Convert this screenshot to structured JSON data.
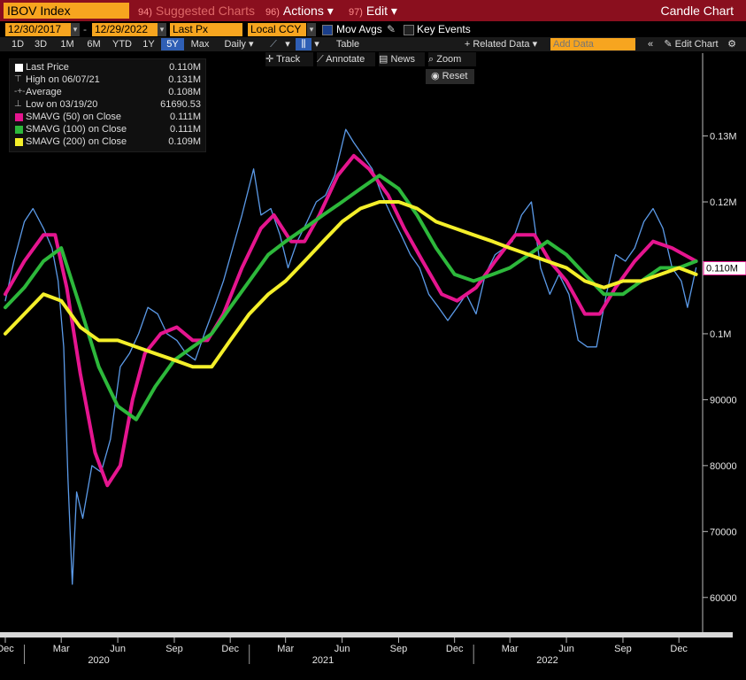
{
  "header": {
    "ticker": "IBOV Index",
    "suggested_num": "94)",
    "suggested_label": "Suggested Charts",
    "actions_num": "96)",
    "actions_label": "Actions ▾",
    "edit_num": "97)",
    "edit_label": "Edit ▾",
    "chart_title": "Candle Chart"
  },
  "toolbar2": {
    "start_date": "12/30/2017",
    "end_date": "12/29/2022",
    "price_field": "Last Px",
    "currency": "Local CCY",
    "mov_avgs_label": "Mov Avgs",
    "key_events_label": "Key Events"
  },
  "periods": [
    "1D",
    "3D",
    "1M",
    "6M",
    "YTD",
    "1Y",
    "5Y",
    "Max"
  ],
  "active_period": "5Y",
  "toolbar3": {
    "frequency": "Daily ▾",
    "table_label": "Table",
    "related_data_label": "+ Related Data ▾",
    "add_data_placeholder": "Add Data",
    "edit_chart_label": "Edit Chart"
  },
  "tools": {
    "track": "Track",
    "annotate": "Annotate",
    "news": "News",
    "zoom": "Zoom",
    "reset": "Reset"
  },
  "legend": [
    {
      "name": "Last Price",
      "value": "0.110M",
      "color": "#ffffff"
    },
    {
      "name": "High on 06/07/21",
      "value": "0.131M",
      "color": "#aaaaaa"
    },
    {
      "name": "Average",
      "value": "0.108M",
      "color": "#aaaaaa"
    },
    {
      "name": "Low on 03/19/20",
      "value": "61690.53",
      "color": "#aaaaaa"
    },
    {
      "name": "SMAVG (50)  on Close",
      "value": "0.111M",
      "color": "#e5158f"
    },
    {
      "name": "SMAVG (100)  on Close",
      "value": "0.111M",
      "color": "#2db83b"
    },
    {
      "name": "SMAVG (200)  on Close",
      "value": "0.109M",
      "color": "#f4ef2a"
    }
  ],
  "last_price_tag": "0.110M",
  "chart_data": {
    "type": "line",
    "ylim": [
      55000,
      138000
    ],
    "y_ticks": [
      {
        "v": 130000,
        "label": "0.13M"
      },
      {
        "v": 120000,
        "label": "0.12M"
      },
      {
        "v": 100000,
        "label": "0.1M"
      },
      {
        "v": 90000,
        "label": "90000"
      },
      {
        "v": 80000,
        "label": "80000"
      },
      {
        "v": 70000,
        "label": "70000"
      },
      {
        "v": 60000,
        "label": "60000"
      }
    ],
    "x_range": [
      "2019-12-01",
      "2022-12-31"
    ],
    "x_month_ticks": [
      {
        "label": "Dec",
        "date": "2019-12-01"
      },
      {
        "label": "Mar",
        "date": "2020-03-01"
      },
      {
        "label": "Jun",
        "date": "2020-06-01"
      },
      {
        "label": "Sep",
        "date": "2020-09-01"
      },
      {
        "label": "Dec",
        "date": "2020-12-01"
      },
      {
        "label": "Mar",
        "date": "2021-03-01"
      },
      {
        "label": "Jun",
        "date": "2021-06-01"
      },
      {
        "label": "Sep",
        "date": "2021-09-01"
      },
      {
        "label": "Dec",
        "date": "2021-12-01"
      },
      {
        "label": "Mar",
        "date": "2022-03-01"
      },
      {
        "label": "Jun",
        "date": "2022-06-01"
      },
      {
        "label": "Sep",
        "date": "2022-09-01"
      },
      {
        "label": "Dec",
        "date": "2022-12-01"
      }
    ],
    "x_year_labels": [
      {
        "label": "2020",
        "date": "2020-05-01"
      },
      {
        "label": "2021",
        "date": "2021-05-01"
      },
      {
        "label": "2022",
        "date": "2022-05-01"
      }
    ],
    "x_year_dividers": [
      "2020-01-01",
      "2021-01-01",
      "2022-01-01"
    ],
    "series": [
      {
        "name": "Last Price",
        "color": "#5b9ae8",
        "points": [
          [
            "2019-12-01",
            105000
          ],
          [
            "2019-12-15",
            111000
          ],
          [
            "2020-01-01",
            117000
          ],
          [
            "2020-01-15",
            119000
          ],
          [
            "2020-02-01",
            116000
          ],
          [
            "2020-02-15",
            113000
          ],
          [
            "2020-02-25",
            108000
          ],
          [
            "2020-03-05",
            98000
          ],
          [
            "2020-03-12",
            78000
          ],
          [
            "2020-03-19",
            62000
          ],
          [
            "2020-03-26",
            76000
          ],
          [
            "2020-04-05",
            72000
          ],
          [
            "2020-04-20",
            80000
          ],
          [
            "2020-05-05",
            79000
          ],
          [
            "2020-05-20",
            84000
          ],
          [
            "2020-06-05",
            95000
          ],
          [
            "2020-06-20",
            97000
          ],
          [
            "2020-07-05",
            100000
          ],
          [
            "2020-07-20",
            104000
          ],
          [
            "2020-08-05",
            103000
          ],
          [
            "2020-08-20",
            100000
          ],
          [
            "2020-09-05",
            99000
          ],
          [
            "2020-09-20",
            97000
          ],
          [
            "2020-10-05",
            96000
          ],
          [
            "2020-10-20",
            100000
          ],
          [
            "2020-11-05",
            104000
          ],
          [
            "2020-11-20",
            108000
          ],
          [
            "2020-12-05",
            113000
          ],
          [
            "2020-12-20",
            118000
          ],
          [
            "2021-01-08",
            125000
          ],
          [
            "2021-01-20",
            118000
          ],
          [
            "2021-02-05",
            119000
          ],
          [
            "2021-02-20",
            115000
          ],
          [
            "2021-03-05",
            110000
          ],
          [
            "2021-03-20",
            114000
          ],
          [
            "2021-04-05",
            117000
          ],
          [
            "2021-04-20",
            120000
          ],
          [
            "2021-05-05",
            121000
          ],
          [
            "2021-05-20",
            124000
          ],
          [
            "2021-06-07",
            131000
          ],
          [
            "2021-06-20",
            129000
          ],
          [
            "2021-07-05",
            127000
          ],
          [
            "2021-07-20",
            125000
          ],
          [
            "2021-08-05",
            121000
          ],
          [
            "2021-08-20",
            118000
          ],
          [
            "2021-09-05",
            115000
          ],
          [
            "2021-09-20",
            112000
          ],
          [
            "2021-10-05",
            110000
          ],
          [
            "2021-10-20",
            106000
          ],
          [
            "2021-11-05",
            104000
          ],
          [
            "2021-11-20",
            102000
          ],
          [
            "2021-12-05",
            104000
          ],
          [
            "2021-12-20",
            106000
          ],
          [
            "2022-01-05",
            103000
          ],
          [
            "2022-01-20",
            109000
          ],
          [
            "2022-02-05",
            112000
          ],
          [
            "2022-02-20",
            113000
          ],
          [
            "2022-03-05",
            114000
          ],
          [
            "2022-03-20",
            118000
          ],
          [
            "2022-04-05",
            120000
          ],
          [
            "2022-04-20",
            110000
          ],
          [
            "2022-05-05",
            106000
          ],
          [
            "2022-05-20",
            109000
          ],
          [
            "2022-06-05",
            106000
          ],
          [
            "2022-06-20",
            99000
          ],
          [
            "2022-07-05",
            98000
          ],
          [
            "2022-07-20",
            98000
          ],
          [
            "2022-08-05",
            106000
          ],
          [
            "2022-08-20",
            112000
          ],
          [
            "2022-09-05",
            111000
          ],
          [
            "2022-09-20",
            113000
          ],
          [
            "2022-10-05",
            117000
          ],
          [
            "2022-10-20",
            119000
          ],
          [
            "2022-11-05",
            116000
          ],
          [
            "2022-11-20",
            110000
          ],
          [
            "2022-12-05",
            108000
          ],
          [
            "2022-12-15",
            104000
          ],
          [
            "2022-12-29",
            110000
          ]
        ]
      },
      {
        "name": "SMAVG (50)  on Close",
        "color": "#e5158f",
        "points": [
          [
            "2019-12-01",
            106000
          ],
          [
            "2020-01-01",
            111000
          ],
          [
            "2020-02-01",
            115000
          ],
          [
            "2020-02-20",
            115000
          ],
          [
            "2020-03-10",
            107000
          ],
          [
            "2020-04-01",
            94000
          ],
          [
            "2020-04-25",
            82000
          ],
          [
            "2020-05-15",
            77000
          ],
          [
            "2020-06-05",
            80000
          ],
          [
            "2020-06-25",
            90000
          ],
          [
            "2020-07-15",
            97000
          ],
          [
            "2020-08-10",
            100000
          ],
          [
            "2020-09-05",
            101000
          ],
          [
            "2020-10-01",
            99000
          ],
          [
            "2020-10-25",
            99000
          ],
          [
            "2020-11-20",
            103000
          ],
          [
            "2020-12-20",
            110000
          ],
          [
            "2021-01-20",
            116000
          ],
          [
            "2021-02-10",
            118000
          ],
          [
            "2021-03-10",
            114000
          ],
          [
            "2021-04-01",
            114000
          ],
          [
            "2021-04-25",
            118000
          ],
          [
            "2021-05-25",
            124000
          ],
          [
            "2021-06-20",
            127000
          ],
          [
            "2021-07-15",
            125000
          ],
          [
            "2021-08-15",
            121000
          ],
          [
            "2021-09-10",
            116000
          ],
          [
            "2021-10-10",
            111000
          ],
          [
            "2021-11-10",
            106000
          ],
          [
            "2021-12-05",
            105000
          ],
          [
            "2022-01-05",
            107000
          ],
          [
            "2022-02-05",
            111000
          ],
          [
            "2022-03-10",
            115000
          ],
          [
            "2022-04-10",
            115000
          ],
          [
            "2022-05-05",
            111000
          ],
          [
            "2022-06-01",
            108000
          ],
          [
            "2022-07-01",
            103000
          ],
          [
            "2022-07-25",
            103000
          ],
          [
            "2022-08-20",
            107000
          ],
          [
            "2022-09-20",
            111000
          ],
          [
            "2022-10-20",
            114000
          ],
          [
            "2022-11-20",
            113000
          ],
          [
            "2022-12-29",
            111000
          ]
        ]
      },
      {
        "name": "SMAVG (100)  on Close",
        "color": "#2db83b",
        "points": [
          [
            "2019-12-01",
            104000
          ],
          [
            "2020-01-01",
            107000
          ],
          [
            "2020-02-01",
            111000
          ],
          [
            "2020-03-01",
            113000
          ],
          [
            "2020-04-01",
            104000
          ],
          [
            "2020-05-01",
            95000
          ],
          [
            "2020-06-01",
            89000
          ],
          [
            "2020-07-01",
            87000
          ],
          [
            "2020-08-01",
            92000
          ],
          [
            "2020-09-01",
            96000
          ],
          [
            "2020-10-01",
            98000
          ],
          [
            "2020-11-01",
            100000
          ],
          [
            "2020-12-01",
            104000
          ],
          [
            "2021-01-01",
            108000
          ],
          [
            "2021-02-01",
            112000
          ],
          [
            "2021-03-01",
            114000
          ],
          [
            "2021-04-01",
            116000
          ],
          [
            "2021-05-01",
            118000
          ],
          [
            "2021-06-01",
            120000
          ],
          [
            "2021-07-01",
            122000
          ],
          [
            "2021-08-01",
            124000
          ],
          [
            "2021-09-01",
            122000
          ],
          [
            "2021-10-01",
            118000
          ],
          [
            "2021-11-01",
            113000
          ],
          [
            "2021-12-01",
            109000
          ],
          [
            "2022-01-01",
            108000
          ],
          [
            "2022-02-01",
            109000
          ],
          [
            "2022-03-01",
            110000
          ],
          [
            "2022-04-01",
            112000
          ],
          [
            "2022-05-01",
            114000
          ],
          [
            "2022-06-01",
            112000
          ],
          [
            "2022-07-01",
            109000
          ],
          [
            "2022-08-01",
            106000
          ],
          [
            "2022-09-01",
            106000
          ],
          [
            "2022-10-01",
            108000
          ],
          [
            "2022-11-01",
            110000
          ],
          [
            "2022-12-01",
            110000
          ],
          [
            "2022-12-29",
            111000
          ]
        ]
      },
      {
        "name": "SMAVG (200)  on Close",
        "color": "#f4ef2a",
        "points": [
          [
            "2019-12-01",
            100000
          ],
          [
            "2020-01-01",
            103000
          ],
          [
            "2020-02-01",
            106000
          ],
          [
            "2020-03-01",
            105000
          ],
          [
            "2020-04-01",
            101000
          ],
          [
            "2020-05-01",
            99000
          ],
          [
            "2020-06-01",
            99000
          ],
          [
            "2020-07-01",
            98000
          ],
          [
            "2020-08-01",
            97000
          ],
          [
            "2020-09-01",
            96000
          ],
          [
            "2020-10-01",
            95000
          ],
          [
            "2020-11-01",
            95000
          ],
          [
            "2020-12-01",
            99000
          ],
          [
            "2021-01-01",
            103000
          ],
          [
            "2021-02-01",
            106000
          ],
          [
            "2021-03-01",
            108000
          ],
          [
            "2021-04-01",
            111000
          ],
          [
            "2021-05-01",
            114000
          ],
          [
            "2021-06-01",
            117000
          ],
          [
            "2021-07-01",
            119000
          ],
          [
            "2021-08-01",
            120000
          ],
          [
            "2021-09-01",
            120000
          ],
          [
            "2021-10-01",
            119000
          ],
          [
            "2021-11-01",
            117000
          ],
          [
            "2021-12-01",
            116000
          ],
          [
            "2022-01-01",
            115000
          ],
          [
            "2022-02-01",
            114000
          ],
          [
            "2022-03-01",
            113000
          ],
          [
            "2022-04-01",
            112000
          ],
          [
            "2022-05-01",
            111000
          ],
          [
            "2022-06-01",
            110000
          ],
          [
            "2022-07-01",
            108000
          ],
          [
            "2022-08-01",
            107000
          ],
          [
            "2022-09-01",
            108000
          ],
          [
            "2022-10-01",
            108000
          ],
          [
            "2022-11-01",
            109000
          ],
          [
            "2022-12-01",
            110000
          ],
          [
            "2022-12-29",
            109000
          ]
        ]
      }
    ]
  }
}
